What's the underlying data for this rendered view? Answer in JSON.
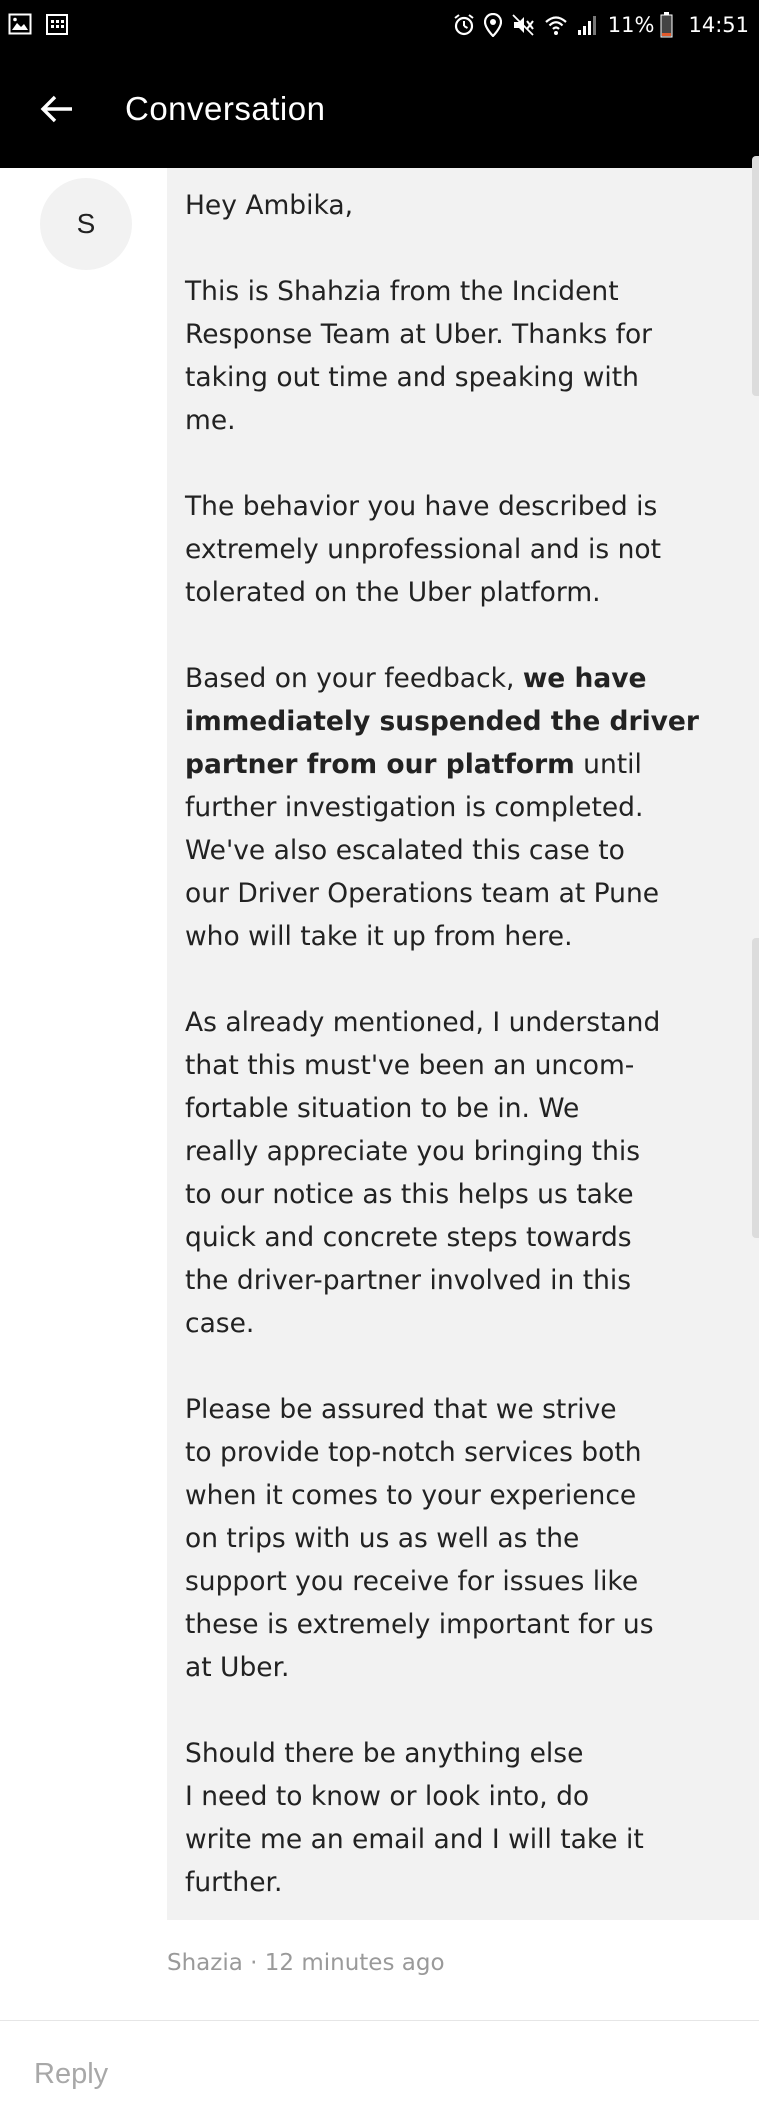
{
  "status_bar": {
    "icons_left": [
      "image-icon",
      "calendar-icon"
    ],
    "icons_right": [
      "alarm-icon",
      "location-icon",
      "mute-icon",
      "wifi-icon",
      "signal-icon"
    ],
    "battery": "11%",
    "time": "14:51"
  },
  "app_bar": {
    "title": "Conversation",
    "back_icon": "arrow-left-icon"
  },
  "message": {
    "avatar_letter": "S",
    "paragraphs": [
      [
        [
          {
            "t": "Hey Ambika,"
          }
        ]
      ],
      [
        [
          {
            "t": "This is Shahzia from the Incident"
          }
        ],
        [
          {
            "t": "Response Team at Uber. Thanks for"
          }
        ],
        [
          {
            "t": "taking out time and speaking with"
          }
        ],
        [
          {
            "t": "me."
          }
        ]
      ],
      [
        [
          {
            "t": "The behavior you have described is"
          }
        ],
        [
          {
            "t": "extremely unprofessional and is not"
          }
        ],
        [
          {
            "t": "tolerated on the Uber platform."
          }
        ]
      ],
      [
        [
          {
            "t": "Based on your feedback, "
          },
          {
            "t": "we have",
            "b": true
          }
        ],
        [
          {
            "t": "immediately suspended the driver",
            "b": true
          }
        ],
        [
          {
            "t": "partner from our platform",
            "b": true
          },
          {
            "t": " until"
          }
        ],
        [
          {
            "t": "further investigation is completed."
          }
        ],
        [
          {
            "t": "We've also escalated this case to"
          }
        ],
        [
          {
            "t": "our Driver Operations team at Pune"
          }
        ],
        [
          {
            "t": "who will take it up from here."
          }
        ]
      ],
      [
        [
          {
            "t": "As already mentioned, I understand"
          }
        ],
        [
          {
            "t": "that this must've been an uncom-"
          }
        ],
        [
          {
            "t": "fortable situation to be in. We"
          }
        ],
        [
          {
            "t": "really appreciate you bringing this"
          }
        ],
        [
          {
            "t": "to our notice as this helps us take"
          }
        ],
        [
          {
            "t": "quick and concrete steps towards"
          }
        ],
        [
          {
            "t": "the driver-partner involved in this"
          }
        ],
        [
          {
            "t": "case."
          }
        ]
      ],
      [
        [
          {
            "t": "Please be assured that we strive"
          }
        ],
        [
          {
            "t": "to provide top-notch services both"
          }
        ],
        [
          {
            "t": "when it comes to your experience"
          }
        ],
        [
          {
            "t": "on trips with us as well as the"
          }
        ],
        [
          {
            "t": "support you receive for issues like"
          }
        ],
        [
          {
            "t": "these is extremely important for us"
          }
        ],
        [
          {
            "t": "at Uber."
          }
        ]
      ],
      [
        [
          {
            "t": "Should there be anything else"
          }
        ],
        [
          {
            "t": "I need to know or look into, do"
          }
        ],
        [
          {
            "t": "write me an email and I will take it"
          }
        ],
        [
          {
            "t": "further."
          }
        ]
      ]
    ],
    "meta": "Shazia · 12 minutes ago"
  },
  "reply": {
    "placeholder": "Reply"
  },
  "colors": {
    "bar_background": "#000000",
    "bubble_background": "#f2f2f2",
    "meta_text": "#9a9a9a"
  }
}
